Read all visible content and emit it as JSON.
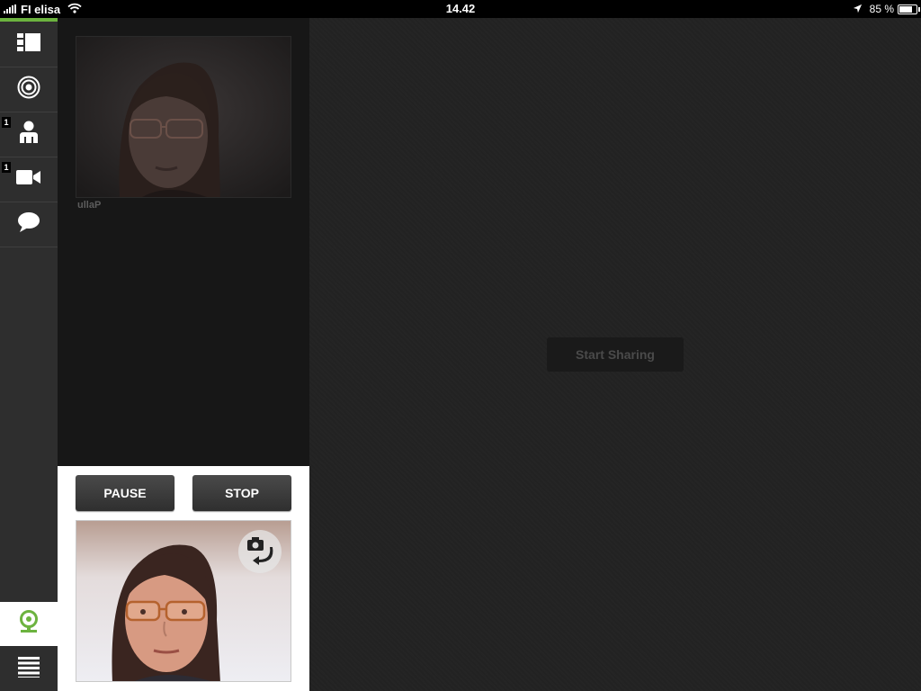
{
  "status_bar": {
    "carrier": "FI elisa",
    "time": "14.42",
    "battery": "85 %",
    "battery_level": 0.85
  },
  "sidebar": {
    "accent_color": "#6cb33f",
    "items": [
      {
        "icon": "layout-icon",
        "badge": ""
      },
      {
        "icon": "target-icon",
        "badge": ""
      },
      {
        "icon": "person-icon",
        "badge": "1"
      },
      {
        "icon": "video-camera-icon",
        "badge": "1"
      },
      {
        "icon": "chat-bubble-icon",
        "badge": ""
      }
    ],
    "bottom_items": [
      {
        "icon": "webcam-icon",
        "active": true
      },
      {
        "icon": "menu-icon",
        "active": false
      }
    ]
  },
  "participants": {
    "remote": [
      {
        "name": "ullaP"
      }
    ]
  },
  "self_view": {
    "pause_label": "PAUSE",
    "stop_label": "STOP",
    "switch_camera_icon": "switch-camera-icon"
  },
  "main": {
    "start_sharing_label": "Start Sharing"
  }
}
